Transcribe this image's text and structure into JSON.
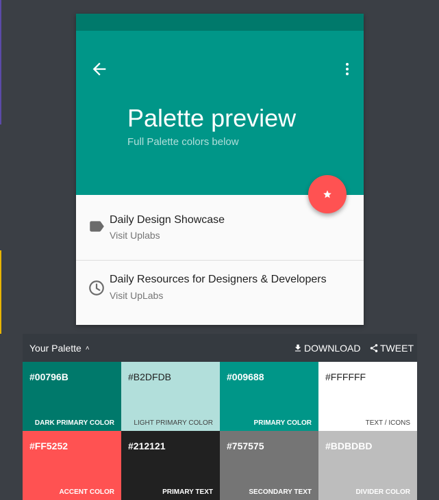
{
  "preview": {
    "title": "Palette preview",
    "subtitle": "Full Palette colors below",
    "back_icon": "arrow-back-icon",
    "more_icon": "more-vert-icon",
    "fab_icon": "star-icon",
    "list": [
      {
        "primary": "Daily Design Showcase",
        "secondary": "Visit Uplabs",
        "icon": "label-icon"
      },
      {
        "primary": "Daily Resources for Designers & Developers",
        "secondary": "Visit UpLabs",
        "icon": "clock-icon"
      }
    ]
  },
  "palette": {
    "title": "Your Palette",
    "download_label": "DOWNLOAD",
    "tweet_label": "TWEET",
    "swatches": [
      {
        "hex": "#00796B",
        "label": "DARK PRIMARY COLOR",
        "color": "#00796b"
      },
      {
        "hex": "#B2DFDB",
        "label": "LIGHT PRIMARY COLOR",
        "color": "#b2dfdb"
      },
      {
        "hex": "#009688",
        "label": "PRIMARY COLOR",
        "color": "#009688"
      },
      {
        "hex": "#FFFFFF",
        "label": "TEXT / ICONS",
        "color": "#ffffff"
      },
      {
        "hex": "#FF5252",
        "label": "ACCENT COLOR",
        "color": "#ff5252"
      },
      {
        "hex": "#212121",
        "label": "PRIMARY TEXT",
        "color": "#212121"
      },
      {
        "hex": "#757575",
        "label": "SECONDARY TEXT",
        "color": "#757575"
      },
      {
        "hex": "#BDBDBD",
        "label": "DIVIDER COLOR",
        "color": "#bdbdbd"
      }
    ]
  }
}
